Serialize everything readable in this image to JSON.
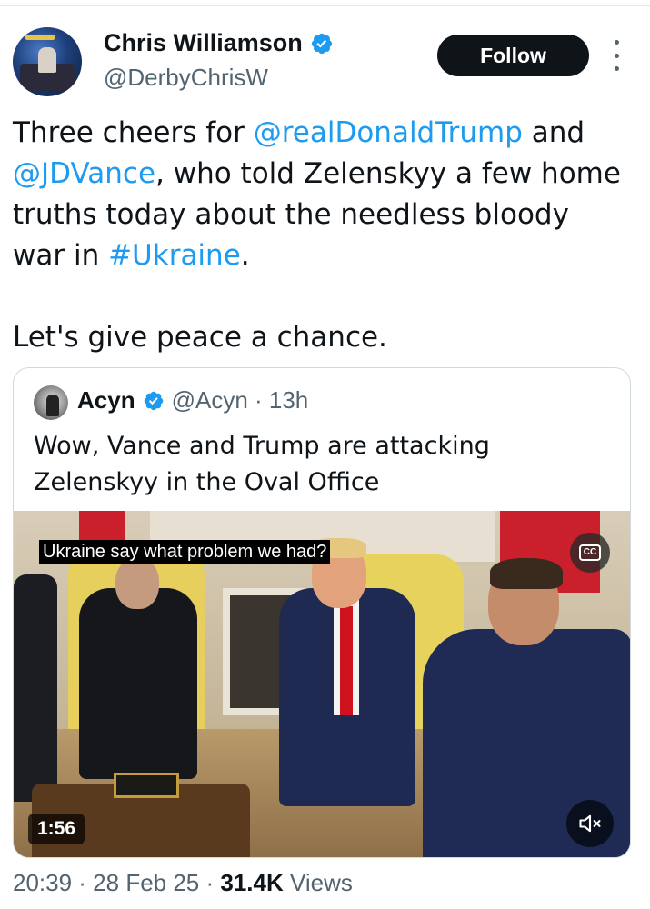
{
  "author": {
    "display_name": "Chris Williamson",
    "handle": "@DerbyChrisW",
    "verified": true
  },
  "actions": {
    "follow_label": "Follow",
    "more_icon": "more-vertical-icon"
  },
  "tweet": {
    "text_lines": [
      {
        "pre": "Three cheers for ",
        "link": "@realDonaldTrump",
        "post": " and"
      },
      {
        "pre": "",
        "link": "@JDVance",
        "post": ", who told Zelenskyy a few home"
      },
      {
        "pre": "truths today about the needless bloody",
        "link": "",
        "post": ""
      },
      {
        "pre": "war in ",
        "link": "#Ukraine",
        "post": "."
      }
    ],
    "closing_line": "Let's give peace a chance."
  },
  "quote": {
    "display_name": "Acyn",
    "verified": true,
    "meta": "@Acyn · 13h",
    "text": "Wow, Vance and Trump are attacking Zelenskyy in the Oval Office",
    "video": {
      "caption": "Ukraine say what problem we had?",
      "cc_label": "CC",
      "duration": "1:56",
      "muted": true
    }
  },
  "footer": {
    "timestamp": "20:39 · 28 Feb 25 · ",
    "views_count": "31.4K",
    "views_label": " Views"
  },
  "colors": {
    "text": "#0f1419",
    "secondary": "#536471",
    "link": "#1d9bf0",
    "verified": "#1d9bf0",
    "button_bg": "#0f1419"
  }
}
